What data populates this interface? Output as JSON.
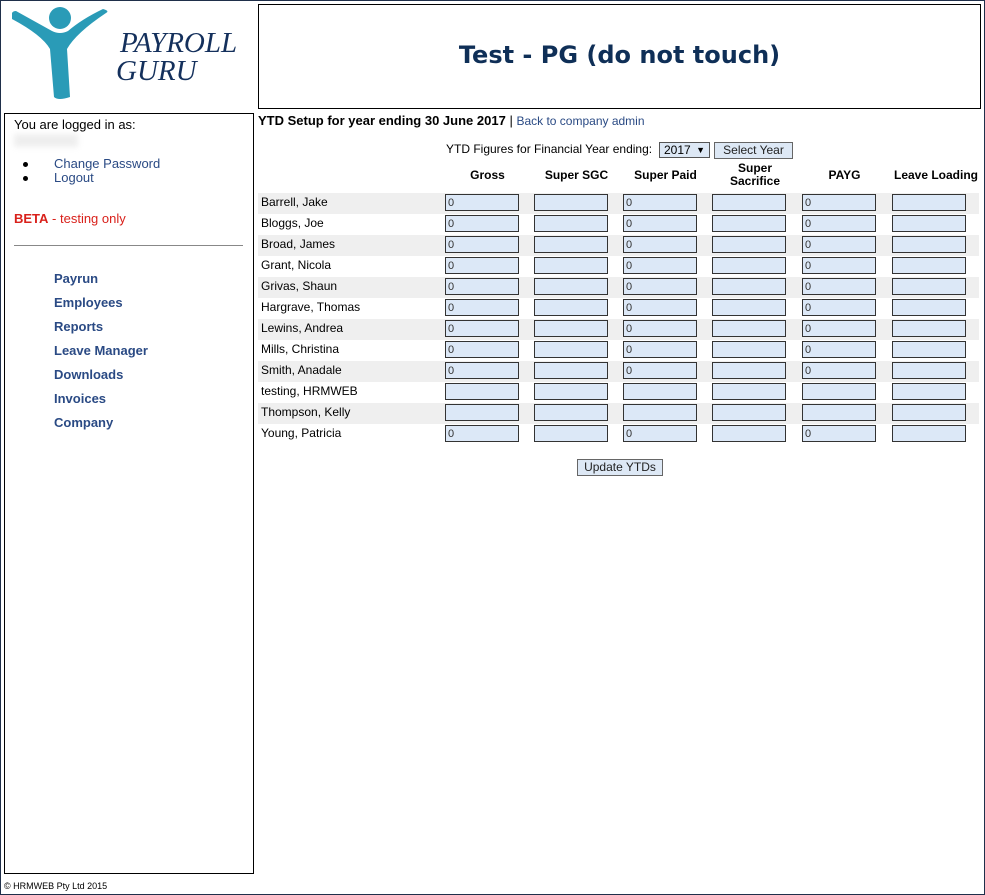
{
  "brand": {
    "line1": "PAYROLL",
    "line2": "GURU",
    "color": "#2a9bb7"
  },
  "header": {
    "title": "Test - PG (do not touch)"
  },
  "sidebar": {
    "logged_in_label": "You are logged in as:",
    "account_links": [
      "Change Password",
      "Logout"
    ],
    "beta": {
      "label": "BETA",
      "rest": " - testing only"
    },
    "nav": [
      "Payrun",
      "Employees",
      "Reports",
      "Leave Manager",
      "Downloads",
      "Invoices",
      "Company"
    ]
  },
  "ytd": {
    "title": "YTD  Setup for year ending 30 June 2017",
    "separator": "|",
    "back_link": "Back to company admin",
    "year_label": "YTD Figures for Financial Year ending:",
    "selected_year": "2017",
    "select_button": "Select Year",
    "update_button": "Update YTDs"
  },
  "table": {
    "columns": [
      "Gross",
      "Super SGC",
      "Super Paid",
      "Super Sacrifice",
      "PAYG",
      "Leave Loading"
    ],
    "rows": [
      {
        "name": "Barrell, Jake",
        "values": [
          "0",
          "",
          "0",
          "",
          "0",
          ""
        ]
      },
      {
        "name": "Bloggs, Joe",
        "values": [
          "0",
          "",
          "0",
          "",
          "0",
          ""
        ]
      },
      {
        "name": "Broad, James",
        "values": [
          "0",
          "",
          "0",
          "",
          "0",
          ""
        ]
      },
      {
        "name": "Grant, Nicola",
        "values": [
          "0",
          "",
          "0",
          "",
          "0",
          ""
        ]
      },
      {
        "name": "Grivas, Shaun",
        "values": [
          "0",
          "",
          "0",
          "",
          "0",
          ""
        ]
      },
      {
        "name": "Hargrave, Thomas",
        "values": [
          "0",
          "",
          "0",
          "",
          "0",
          ""
        ]
      },
      {
        "name": "Lewins, Andrea",
        "values": [
          "0",
          "",
          "0",
          "",
          "0",
          ""
        ]
      },
      {
        "name": "Mills, Christina",
        "values": [
          "0",
          "",
          "0",
          "",
          "0",
          ""
        ]
      },
      {
        "name": "Smith, Anadale",
        "values": [
          "0",
          "",
          "0",
          "",
          "0",
          ""
        ]
      },
      {
        "name": "testing, HRMWEB",
        "values": [
          "",
          "",
          "",
          "",
          "",
          ""
        ]
      },
      {
        "name": "Thompson, Kelly",
        "values": [
          "",
          "",
          "",
          "",
          "",
          ""
        ]
      },
      {
        "name": "Young, Patricia",
        "values": [
          "0",
          "",
          "0",
          "",
          "0",
          ""
        ]
      }
    ]
  },
  "footer": {
    "text": "© HRMWEB Pty Ltd 2015"
  }
}
